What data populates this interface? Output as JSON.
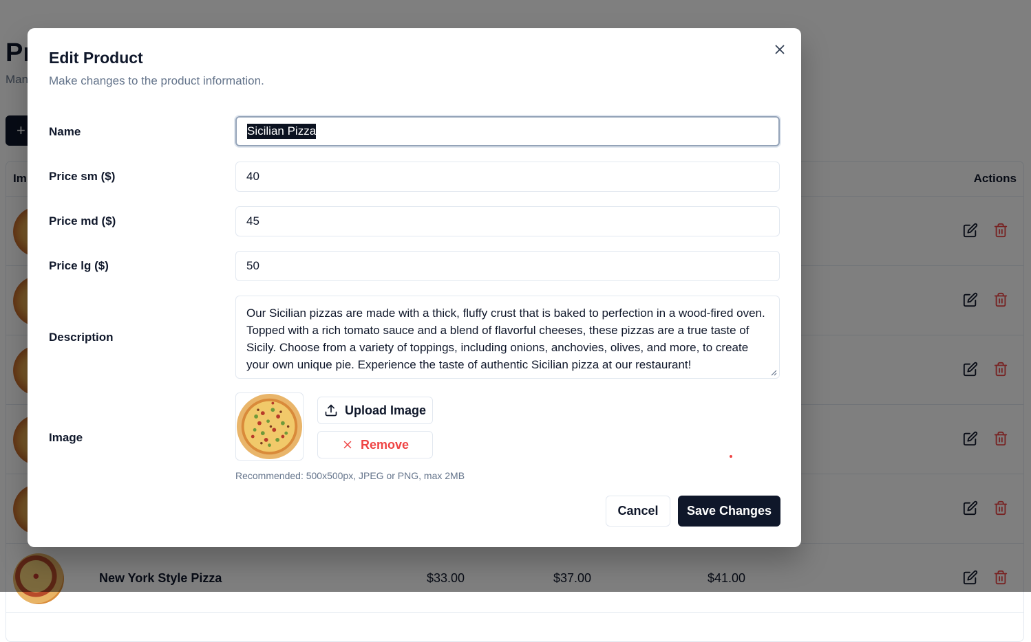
{
  "background": {
    "page_title": "Pr",
    "page_subtitle": "Man",
    "add_button_label": "+",
    "table": {
      "headers": {
        "image": "Im",
        "actions": "Actions"
      },
      "last_row": {
        "name": "New York Style Pizza",
        "price_sm": "$33.00",
        "price_md": "$37.00",
        "price_lg": "$41.00"
      }
    }
  },
  "modal": {
    "title": "Edit Product",
    "description": "Make changes to the product information.",
    "close_icon": "x-icon",
    "fields": {
      "name": {
        "label": "Name",
        "value": "Sicilian Pizza"
      },
      "price_sm": {
        "label": "Price sm ($)",
        "value": "40"
      },
      "price_md": {
        "label": "Price md ($)",
        "value": "45"
      },
      "price_lg": {
        "label": "Price lg ($)",
        "value": "50"
      },
      "description": {
        "label": "Description",
        "value": "Our Sicilian pizzas are made with a thick, fluffy crust that is baked to perfection in a wood-fired oven. Topped with a rich tomato sauce and a blend of flavorful cheeses, these pizzas are a true taste of Sicily. Choose from a variety of toppings, including onions, anchovies, olives, and more, to create your own unique pie. Experience the taste of authentic Sicilian pizza at our restaurant!"
      },
      "image": {
        "label": "Image",
        "upload_label": "Upload Image",
        "remove_label": "Remove",
        "hint": "Recommended: 500x500px, JPEG or PNG, max 2MB"
      }
    },
    "cancel_label": "Cancel",
    "save_label": "Save Changes"
  },
  "colors": {
    "primary": "#0f172a",
    "muted_text": "#64748b",
    "border": "#e2e8f0",
    "danger": "#ef4444"
  }
}
